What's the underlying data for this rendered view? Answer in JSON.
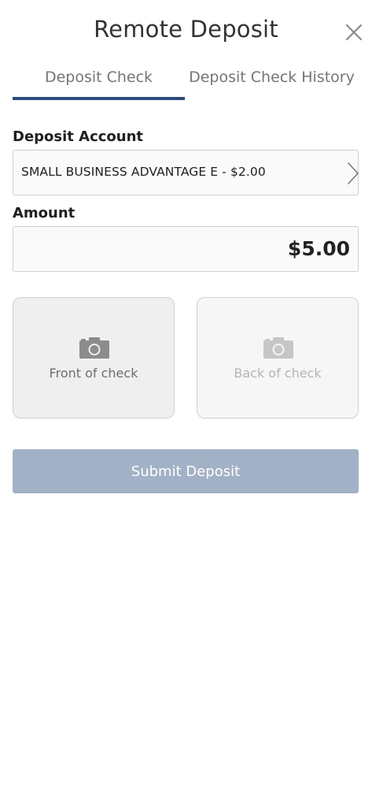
{
  "header": {
    "title": "Remote Deposit",
    "close_icon": "close-icon"
  },
  "tabs": [
    {
      "label": "Deposit Check",
      "active": true
    },
    {
      "label": "Deposit Check History",
      "active": false
    }
  ],
  "form": {
    "deposit_account_label": "Deposit Account",
    "deposit_account_value": "SMALL BUSINESS ADVANTAGE E - $2.00",
    "amount_label": "Amount",
    "amount_value": "$5.00"
  },
  "check_capture": {
    "front_label": "Front of check",
    "back_label": "Back of check",
    "icon": "camera-icon"
  },
  "submit": {
    "label": "Submit Deposit"
  },
  "colors": {
    "accent": "#2e4b7b",
    "submit_disabled": "#a3b1c6"
  }
}
